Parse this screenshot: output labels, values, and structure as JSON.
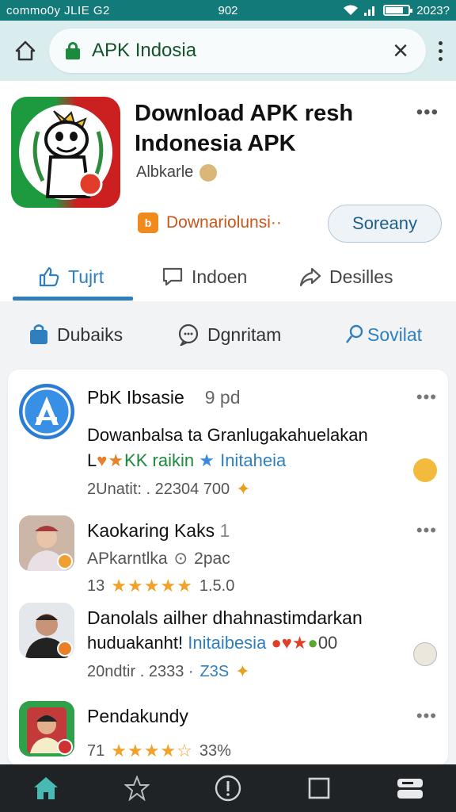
{
  "status_bar": {
    "left_text": "commo0y JLIE G2",
    "center_text": "902",
    "right_text": "2023?",
    "battery_level": 0.8
  },
  "url_bar": {
    "url_text": "APK Indosia"
  },
  "app": {
    "title": "Download APK resh Indonesia APK",
    "developer": "Albkarle",
    "download_label": "Downariolunsi··",
    "secondary_button": "Soreany",
    "tabs": [
      {
        "label": "Tujrt",
        "icon": "thumbs-up-icon",
        "active": true
      },
      {
        "label": "Indoen",
        "icon": "chat-icon",
        "active": false
      },
      {
        "label": "Desilles",
        "icon": "share-icon",
        "active": false
      }
    ]
  },
  "filters": [
    {
      "label": "Dubaiks",
      "icon": "bag-icon"
    },
    {
      "label": "Dgnritam",
      "icon": "comment-icon"
    },
    {
      "label": "Sovilat",
      "icon": "user-search-icon"
    }
  ],
  "items": [
    {
      "title": "PbK Ibsasie",
      "title_extra": "9 pd",
      "line1": "Dowanbalsa ta Granlugakahuelakan",
      "line2_prefix": "L",
      "line2_mid": "KK raikin",
      "line2_blue": "Initaheia",
      "meta": "2Unatit: .  22304  700"
    },
    {
      "title": "Kaokaring Kaks",
      "title_extra": "1",
      "line1": "APkarntlka",
      "line1_extra": "2pac",
      "meta_prefix": "13",
      "rating": "★★★★★",
      "meta_suffix": "1.5.0"
    },
    {
      "title": "Danolals ailher dhahnastimdarkan",
      "line1": "huduakanht!",
      "line1_blue": "Initaibesia",
      "line1_suffix": "00",
      "meta": "20ndtir  .  2333 ·",
      "meta_blue": "Z3S"
    },
    {
      "title": "Pendakundy",
      "meta_prefix": "71",
      "rating": "★★★★☆",
      "meta_suffix": "33%"
    }
  ],
  "bottom_nav": [
    {
      "icon": "home-icon",
      "active": true
    },
    {
      "icon": "star-icon",
      "active": false
    },
    {
      "icon": "info-icon",
      "active": false
    },
    {
      "icon": "square-icon",
      "active": false
    },
    {
      "icon": "wallet-icon",
      "active": false
    }
  ],
  "colors": {
    "status_bar": "#127a78",
    "accent_blue": "#2f7fbf",
    "download_orange": "#c8571b"
  }
}
